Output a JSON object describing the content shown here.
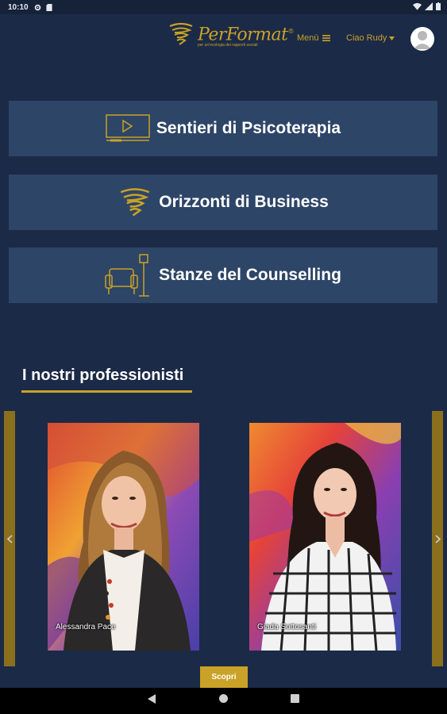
{
  "status_bar": {
    "time": "10:10"
  },
  "header": {
    "logo_name": "PerFormat",
    "logo_registered": "®",
    "logo_tagline": "per un'ecologia dei rapporti sociali",
    "menu_label": "Menù",
    "user_greeting": "Ciao Rudy"
  },
  "categories": [
    {
      "label": "Sentieri di Psicoterapia",
      "icon": "video-player-icon"
    },
    {
      "label": "Orizzonti di Business",
      "icon": "swirl-logo-icon"
    },
    {
      "label": "Stanze del Counselling",
      "icon": "armchair-lamp-icon"
    }
  ],
  "professionals_section": {
    "title": "I nostri professionisti",
    "items": [
      {
        "name": "Alessandra Pace"
      },
      {
        "name": "Giada Sottosanti"
      }
    ],
    "discover_label": "Scopri"
  },
  "colors": {
    "background": "#1b2a47",
    "card": "#2d4567",
    "accent_gold": "#c9a227"
  }
}
